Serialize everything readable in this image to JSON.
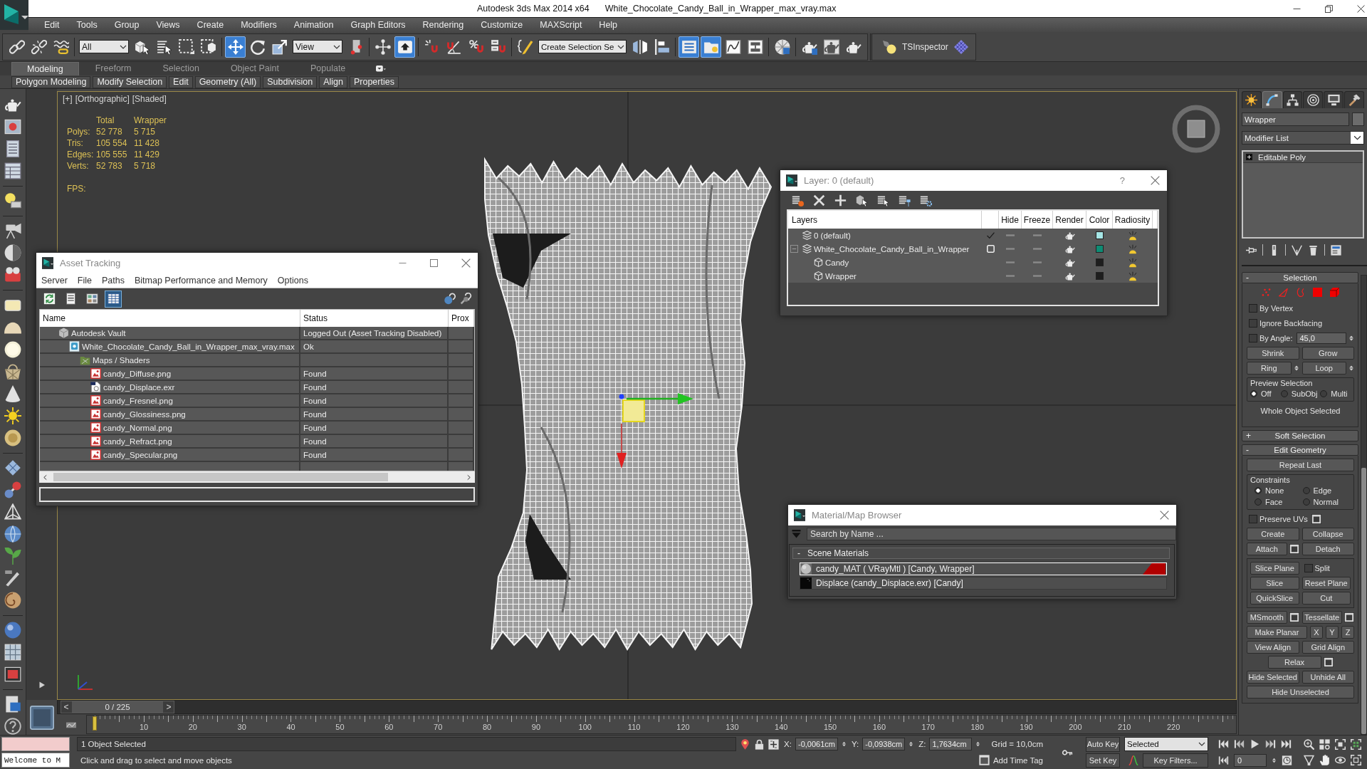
{
  "title_bar": {
    "app_name": "Autodesk 3ds Max 2014 x64",
    "file_name": "White_Chocolate_Candy_Ball_in_Wrapper_max_vray.max"
  },
  "menu_bar": [
    "Edit",
    "Tools",
    "Group",
    "Views",
    "Create",
    "Modifiers",
    "Animation",
    "Graph Editors",
    "Rendering",
    "Customize",
    "MAXScript",
    "Help"
  ],
  "main_toolbar": {
    "groups": [
      {
        "items": [
          {
            "kind": "button",
            "active": false
          },
          {
            "kind": "button",
            "active": false
          },
          {
            "kind": "button",
            "active": false
          }
        ]
      },
      {
        "items": [
          {
            "kind": "dropdown",
            "value": "All"
          },
          {
            "kind": "button",
            "active": false
          },
          {
            "kind": "button",
            "active": false
          },
          {
            "kind": "button",
            "active": false
          },
          {
            "kind": "button",
            "active": false
          }
        ]
      },
      {
        "items": [
          {
            "kind": "button",
            "active": true
          },
          {
            "kind": "button",
            "active": false
          },
          {
            "kind": "button",
            "active": false
          },
          {
            "kind": "dropdown",
            "value": "View"
          },
          {
            "kind": "button",
            "active": false
          }
        ]
      },
      {
        "items": [
          {
            "kind": "button",
            "active": false
          },
          {
            "kind": "button",
            "active": true
          }
        ]
      },
      {
        "items": [
          {
            "kind": "button",
            "active": false
          },
          {
            "kind": "button",
            "active": false
          },
          {
            "kind": "button",
            "active": false
          },
          {
            "kind": "button",
            "active": false
          }
        ]
      },
      {
        "items": [
          {
            "kind": "button",
            "active": false
          },
          {
            "kind": "dropdown",
            "value": "Create Selection Se"
          },
          {
            "kind": "button",
            "active": false
          },
          {
            "kind": "button",
            "active": false
          }
        ]
      },
      {
        "items": [
          {
            "kind": "button",
            "active": true
          },
          {
            "kind": "button",
            "active": true
          },
          {
            "kind": "button",
            "active": false
          },
          {
            "kind": "button",
            "active": false
          }
        ]
      },
      {
        "items": [
          {
            "kind": "button",
            "active": false
          }
        ]
      },
      {
        "items": [
          {
            "kind": "button",
            "active": false
          },
          {
            "kind": "button",
            "active": false
          },
          {
            "kind": "button",
            "active": false
          }
        ]
      }
    ]
  },
  "plugin_toolbar": {
    "label": "TSInspector"
  },
  "ribbon": {
    "tabs": [
      {
        "label": "Modeling",
        "selected": true
      },
      {
        "label": "Freeform",
        "selected": false
      },
      {
        "label": "Selection",
        "selected": false
      },
      {
        "label": "Object Paint",
        "selected": false
      },
      {
        "label": "Populate",
        "selected": false
      }
    ],
    "panels": [
      "Polygon Modeling",
      "Modify Selection",
      "Edit",
      "Geometry (All)",
      "Subdivision",
      "Align",
      "Properties"
    ]
  },
  "viewport": {
    "labels": [
      "[+]",
      "[Orthographic]",
      "[Shaded]"
    ],
    "stats": {
      "columns": [
        "Total",
        "Wrapper"
      ],
      "rows": [
        {
          "label": "Polys:",
          "values": [
            "52 778",
            "5 715"
          ]
        },
        {
          "label": "Tris:",
          "values": [
            "105 554",
            "11 428"
          ]
        },
        {
          "label": "Edges:",
          "values": [
            "105 555",
            "11 429"
          ]
        },
        {
          "label": "Verts:",
          "values": [
            "52 783",
            "5 718"
          ]
        }
      ],
      "fps_label": "FPS:"
    }
  },
  "asset_tracking": {
    "title": "Asset Tracking",
    "menu": [
      "Server",
      "File",
      "Paths",
      "Bitmap Performance and Memory",
      "Options"
    ],
    "toolbar": [
      {
        "active": false
      },
      {
        "active": false
      },
      {
        "active": false
      },
      {
        "active": true
      }
    ],
    "columns": [
      "Name",
      "Status",
      "Prox"
    ],
    "rows": [
      {
        "kind": "vault",
        "name": "Autodesk Vault",
        "status": "Logged Out (Asset Tracking Disabled)",
        "children": [
          {
            "kind": "scene",
            "name": "White_Chocolate_Candy_Ball_in_Wrapper_max_vray.max",
            "status": "Ok",
            "children": [
              {
                "kind": "folder",
                "name": "Maps / Shaders",
                "children": [
                  {
                    "kind": "bitmap",
                    "name": "candy_Diffuse.png",
                    "status": "Found"
                  },
                  {
                    "kind": "exr",
                    "name": "candy_Displace.exr",
                    "status": "Found"
                  },
                  {
                    "kind": "bitmap",
                    "name": "candy_Fresnel.png",
                    "status": "Found"
                  },
                  {
                    "kind": "bitmap",
                    "name": "candy_Glossiness.png",
                    "status": "Found"
                  },
                  {
                    "kind": "bitmap",
                    "name": "candy_Normal.png",
                    "status": "Found"
                  },
                  {
                    "kind": "bitmap",
                    "name": "candy_Refract.png",
                    "status": "Found"
                  },
                  {
                    "kind": "bitmap",
                    "name": "candy_Specular.png",
                    "status": "Found"
                  }
                ]
              }
            ]
          }
        ]
      }
    ]
  },
  "layer_manager": {
    "title": "Layer: 0 (default)",
    "help": "?",
    "columns": [
      "Layers",
      "Hide",
      "Freeze",
      "Render",
      "Color",
      "Radiosity"
    ],
    "rows": [
      {
        "kind": "layer",
        "name": "0 (default)",
        "current": true,
        "hidden": false,
        "frozen": false,
        "renderable": true,
        "color": "#a6e6e6"
      },
      {
        "kind": "layer",
        "name": "White_Chocolate_Candy_Ball_in_Wrapper",
        "current": false,
        "expanded": true,
        "hidden": false,
        "frozen": false,
        "renderable": true,
        "color": "#0e8c74",
        "children": [
          {
            "kind": "object",
            "name": "Candy",
            "hidden": false,
            "frozen": false,
            "renderable": true,
            "color": "#1e1e1e"
          },
          {
            "kind": "object",
            "name": "Wrapper",
            "hidden": false,
            "frozen": false,
            "renderable": true,
            "color": "#1e1e1e"
          }
        ]
      }
    ]
  },
  "material_browser": {
    "title": "Material/Map Browser",
    "search_placeholder": "Search by Name ...",
    "groups": [
      {
        "toggle": "-",
        "label": "Scene Materials",
        "items": [
          {
            "kind": "material",
            "label": "candy_MAT ( VRayMtl ) [Candy, Wrapper]",
            "selected": true,
            "corner_flag": true
          },
          {
            "kind": "map",
            "label": "Displace (candy_Displace.exr) [Candy]",
            "selected": false,
            "corner_flag": false
          }
        ]
      }
    ]
  },
  "command_panel": {
    "tabs": [
      {
        "selected": false
      },
      {
        "selected": true
      },
      {
        "selected": false
      },
      {
        "selected": false
      },
      {
        "selected": false
      },
      {
        "selected": false
      }
    ],
    "object_name": "Wrapper",
    "modifier_list": "Modifier List",
    "stack": [
      {
        "label": "Editable Poly",
        "expanded": false
      }
    ],
    "rollouts": [
      {
        "toggle": "-",
        "title": "Selection",
        "sections": [
          {
            "kind": "subobjects",
            "levels": [
              {
                "selected": false
              },
              {
                "selected": false
              },
              {
                "selected": false
              },
              {
                "selected": false
              },
              {
                "selected": false
              }
            ]
          },
          {
            "kind": "controls",
            "rows": [
              [
                {
                  "kind": "checkbox",
                  "label": "By Vertex",
                  "checked": false
                }
              ],
              [
                {
                  "kind": "checkbox",
                  "label": "Ignore Backfacing",
                  "checked": false
                }
              ],
              [
                {
                  "kind": "checkbox",
                  "label": "By Angle:",
                  "checked": false
                },
                {
                  "kind": "spinner",
                  "value": "45,0"
                }
              ],
              [
                {
                  "kind": "button",
                  "label": "Shrink"
                },
                {
                  "kind": "button",
                  "label": "Grow"
                }
              ],
              [
                {
                  "kind": "spin_button",
                  "label": "Ring"
                },
                {
                  "kind": "spin_button",
                  "label": "Loop"
                }
              ]
            ]
          },
          {
            "kind": "radios",
            "title": "Preview Selection",
            "options": [
              {
                "label": "Off",
                "selected": true
              },
              {
                "label": "SubObj",
                "selected": false
              },
              {
                "label": "Multi",
                "selected": false
              }
            ]
          },
          {
            "kind": "note",
            "text": "Whole Object Selected"
          }
        ]
      },
      {
        "toggle": "+",
        "title": "Soft Selection"
      },
      {
        "toggle": "-",
        "title": "Edit Geometry",
        "sections": [
          {
            "kind": "controls",
            "rows": [
              [
                {
                  "kind": "button",
                  "label": "Repeat Last"
                }
              ]
            ]
          },
          {
            "kind": "radios",
            "title": "Constraints",
            "options": [
              {
                "label": "None",
                "selected": true
              },
              {
                "label": "Edge",
                "selected": false
              },
              {
                "label": "Face",
                "selected": false
              },
              {
                "label": "Normal",
                "selected": false
              }
            ]
          },
          {
            "kind": "controls",
            "rows": [
              [
                {
                  "kind": "settings_checkbox",
                  "label": "Preserve UVs",
                  "checked": false
                }
              ],
              [
                {
                  "kind": "button",
                  "label": "Create"
                },
                {
                  "kind": "button",
                  "label": "Collapse"
                }
              ],
              [
                {
                  "kind": "settings_button",
                  "label": "Attach"
                },
                {
                  "kind": "button",
                  "label": "Detach"
                }
              ]
            ]
          },
          {
            "kind": "boxed_controls",
            "rows": [
              [
                {
                  "kind": "button",
                  "label": "Slice Plane"
                },
                {
                  "kind": "checkbox",
                  "label": "Split",
                  "checked": false
                }
              ],
              [
                {
                  "kind": "button",
                  "label": "Slice"
                },
                {
                  "kind": "button",
                  "label": "Reset Plane"
                }
              ],
              [
                {
                  "kind": "button",
                  "label": "QuickSlice"
                },
                {
                  "kind": "button",
                  "label": "Cut"
                }
              ]
            ]
          },
          {
            "kind": "controls",
            "rows": [
              [
                {
                  "kind": "settings_button",
                  "label": "MSmooth"
                },
                {
                  "kind": "settings_button",
                  "label": "Tessellate"
                }
              ],
              [
                {
                  "kind": "button",
                  "label": "Make Planar"
                },
                {
                  "kind": "button",
                  "label": "X"
                },
                {
                  "kind": "button",
                  "label": "Y"
                },
                {
                  "kind": "button",
                  "label": "Z"
                }
              ],
              [
                {
                  "kind": "button",
                  "label": "View Align"
                },
                {
                  "kind": "button",
                  "label": "Grid Align"
                }
              ],
              [
                {
                  "kind": "settings_button",
                  "label": "Relax"
                }
              ],
              [
                {
                  "kind": "button",
                  "label": "Hide Selected"
                },
                {
                  "kind": "button",
                  "label": "Unhide All"
                }
              ],
              [
                {
                  "kind": "button",
                  "label": "Hide Unselected"
                }
              ]
            ]
          }
        ]
      }
    ]
  },
  "time_slider": {
    "prev": "<",
    "position": "0 / 225",
    "next": ">",
    "level": 0
  },
  "track_bar": {
    "labels": [
      "10",
      "20",
      "30",
      "40",
      "50",
      "60",
      "70",
      "80",
      "90",
      "100",
      "110",
      "120",
      "130",
      "140",
      "150",
      "160",
      "170",
      "180",
      "190",
      "200",
      "210",
      "220"
    ]
  },
  "status_bar": {
    "listener_output": "Welcome to M",
    "selection_info": "1 Object Selected",
    "prompt": "Click and drag to select and move objects",
    "coordinates": [
      {
        "axis": "X:",
        "value": "-0,0061cm"
      },
      {
        "axis": "Y:",
        "value": "-0,0938cm"
      },
      {
        "axis": "Z:",
        "value": "1,7634cm"
      }
    ],
    "grid": "Grid = 10,0cm",
    "time_tag": "Add Time Tag",
    "auto_key": {
      "label": "Auto Key",
      "on": false
    },
    "set_key": "Set Key",
    "key_set": "Selected",
    "key_filters": "Key Filters...",
    "frame": "0"
  }
}
